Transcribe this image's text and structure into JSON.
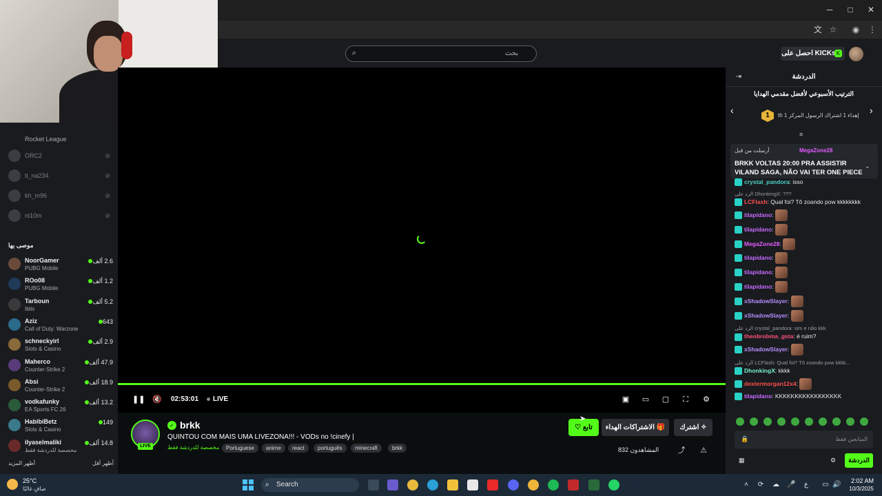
{
  "browser": {
    "window_buttons": [
      "─",
      "□",
      "✕"
    ],
    "chrome_icons": [
      "translate-icon",
      "star-icon",
      "account-icon",
      "menu-icon"
    ]
  },
  "header": {
    "search_placeholder": "بحث",
    "kicks_label": "احصل على KICKs"
  },
  "sidebar": {
    "top_category": "Rocket League",
    "offline": [
      {
        "name": "ORC2"
      },
      {
        "name": "ti_na234"
      },
      {
        "name": "kh_m96"
      },
      {
        "name": "ni10m"
      }
    ],
    "recommended_title": "موصى بها",
    "recommended": [
      {
        "name": "NoorGamer",
        "game": "PUBG Mobile",
        "viewers": "2.6 ألف",
        "avatar_color": "#6a4a3a"
      },
      {
        "name": "ROo08",
        "game": "PUBG Mobile",
        "viewers": "1.2 ألف",
        "avatar_color": "#203a5a"
      },
      {
        "name": "Tarboun",
        "game": "Iblis",
        "viewers": "5.2 ألف",
        "avatar_color": "#3a3a3a"
      },
      {
        "name": "Aziz",
        "game": "Call of Duty: Warzone",
        "viewers": "643",
        "avatar_color": "#2a6a8a"
      },
      {
        "name": "schneckyirl",
        "game": "Slots & Casino",
        "viewers": "2.9 ألف",
        "avatar_color": "#8a6a3a"
      },
      {
        "name": "Maherco",
        "game": "Counter-Strike 2",
        "viewers": "47.9 ألف",
        "avatar_color": "#5a3a7a"
      },
      {
        "name": "Absi",
        "game": "Counter-Strike 2",
        "viewers": "18.9 ألف",
        "avatar_color": "#7a5a2a"
      },
      {
        "name": "vodkafunky",
        "game": "EA Sports FC 26",
        "viewers": "13.2 ألف",
        "avatar_color": "#2a5a3a"
      },
      {
        "name": "HabibiBetz",
        "game": "Slots & Casino",
        "viewers": "149",
        "avatar_color": "#3a7a8a"
      },
      {
        "name": "ilyaselmaliki",
        "game": "مخصصة للدردشة فقط",
        "viewers": "14.8 ألف",
        "avatar_color": "#6a2a2a"
      }
    ],
    "show_more": "أظهر المزيد",
    "show_less": "أظهر أقل"
  },
  "player": {
    "time": "02:53:01",
    "live": "LIVE"
  },
  "stream": {
    "streamer": "brkk",
    "live_badge": "LIVE",
    "title": "QUINTOU COM MAIS UMA LIVEZONA!!! - VODs no !cinefy |",
    "lang_note": "مخصصة للدردشة فقط",
    "tags": [
      "Portuguese",
      "anime",
      "react",
      "português",
      "minecraft",
      "brkk"
    ],
    "follow": "تابع",
    "gift_subs": "الاشتراكات الهداء",
    "subscribe": "اشترك",
    "viewers": "المشاهدون 832",
    "accent": "#53fc18"
  },
  "chat": {
    "title": "الدردشة",
    "leaderboard_title": "الترتيب الأسبوعي لأفضل مقدمي الهدايا",
    "leaderboard_rank": "1",
    "leaderboard_sub": "إهداء 1 اشتراك الرسول المركز 1 th",
    "pinned_by": "أرسلت من قبل",
    "pinned_user": "MegaZone28",
    "pinned_message": "BRKK VOLTAS 20:00 PRA ASSISTIR VILAND SAGA, NÃO VAI TER ONE PIECE",
    "messages": [
      {
        "type": "msg",
        "user": "crystal_pandora",
        "color": "#4fd1c5",
        "text": "isso"
      },
      {
        "type": "reply",
        "text": "الرد على DhonkingX: ???"
      },
      {
        "type": "msg",
        "user": "LCFlash",
        "color": "#ff4f4f",
        "text": "Qual foi? Tô zoando pow kkkkkkkk"
      },
      {
        "type": "msg",
        "user": "tilapidano",
        "color": "#c86bff",
        "text": "",
        "emote": true
      },
      {
        "type": "msg",
        "user": "tilapidano",
        "color": "#c86bff",
        "text": "",
        "emote": true
      },
      {
        "type": "msg",
        "user": "MegaZone28",
        "color": "#e55cff",
        "text": "",
        "emote": true
      },
      {
        "type": "msg",
        "user": "tilapidano",
        "color": "#c86bff",
        "text": "",
        "emote": true
      },
      {
        "type": "msg",
        "user": "tilapidano",
        "color": "#c86bff",
        "text": "",
        "emote": true
      },
      {
        "type": "msg",
        "user": "tilapidano",
        "color": "#c86bff",
        "text": "",
        "emote": true
      },
      {
        "type": "msg",
        "user": "xShadowSlayer",
        "color": "#b78cff",
        "text": "",
        "emote": true
      },
      {
        "type": "msg",
        "user": "xShadowSlayer",
        "color": "#b78cff",
        "text": "",
        "emote": true
      },
      {
        "type": "reply",
        "text": "الرد على crystal_pandora: sim e não kkk"
      },
      {
        "type": "msg",
        "user": "theobrobma_gsta",
        "color": "#ff4f7a",
        "text": "é ruim?"
      },
      {
        "type": "msg",
        "user": "xShadowSlayer",
        "color": "#b78cff",
        "text": "",
        "emote": true
      },
      {
        "type": "reply",
        "text": "الرد على LCFlash: Qual foi? Tô zoando pow kkkk..."
      },
      {
        "type": "msg",
        "user": "DhonkingX",
        "color": "#7cf2c8",
        "text": "kkkk"
      },
      {
        "type": "msg",
        "user": "dextermorgan12x4",
        "color": "#ff4f4f",
        "text": "",
        "emote": true
      },
      {
        "type": "msg",
        "user": "tilapidano",
        "color": "#c86bff",
        "text": "KKKKKKKKKKKKKKKKK"
      }
    ],
    "input_placeholder": "المتابعين فقط",
    "send": "الدردشة"
  },
  "taskbar": {
    "weather_temp": "25°C",
    "weather_desc": "صافٍ غالبًا",
    "search": "Search",
    "time": "2:02 AM",
    "date": "10/3/2025"
  }
}
